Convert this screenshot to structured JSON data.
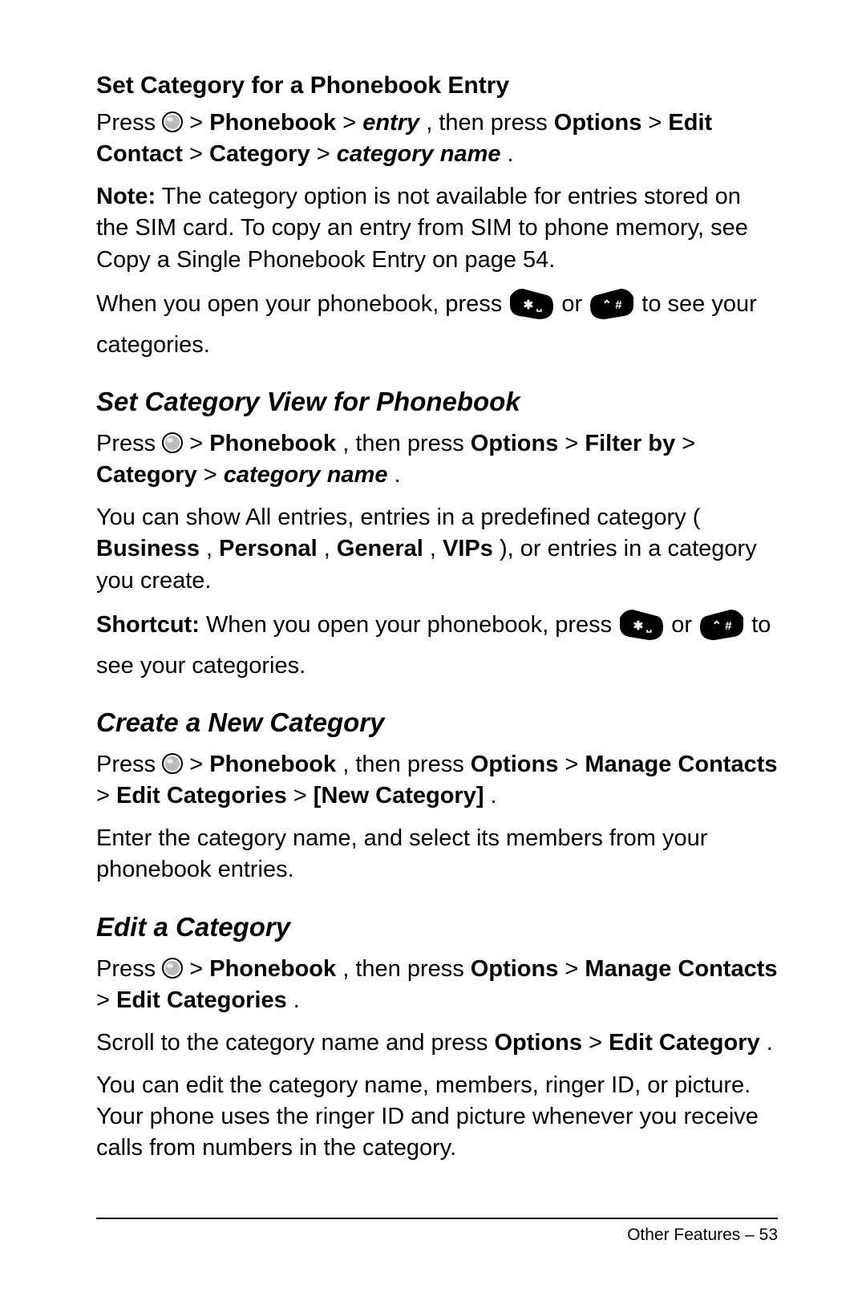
{
  "s1": {
    "title": "Set Category for a Phonebook Entry",
    "p1a": "Press ",
    "p1b": " > ",
    "p1c": "Phonebook",
    "p1d": " > ",
    "p1e": "entry",
    "p1f": ", then press ",
    "p1g": "Options",
    "p1h": " > ",
    "p1i": "Edit Contact",
    "p1j": " > ",
    "p1k": "Category",
    "p1l": " > ",
    "p1m": "category name",
    "p1n": ".",
    "note_label": "Note:",
    "note_text": " The category option is not available for entries stored on the SIM card. To copy an entry from SIM to phone memory, see Copy a Single Phonebook Entry on page 54.",
    "p3a": "When you open your phonebook, press ",
    "p3b": " or ",
    "p3c": " to see your categories."
  },
  "s2": {
    "heading": "Set Category View for Phonebook",
    "p1a": "Press ",
    "p1c": "Phonebook",
    "p1d": ", then press ",
    "p1e": "Options",
    "p1f": " > ",
    "p1g": "Filter by",
    "p1h": " > ",
    "p1i": "Category",
    "p1j": " > ",
    "p1k": "category name",
    "p1l": ".",
    "p2a": "You can show All entries, entries in a predefined category (",
    "p2b": "Business",
    "p2c": ", ",
    "p2d": "Personal",
    "p2e": ", ",
    "p2f": "General",
    "p2g": ", ",
    "p2h": "VIPs",
    "p2i": "), or entries in a category you create.",
    "p3a": "Shortcut:",
    "p3b": " When you open your phonebook, press ",
    "p3c": " or ",
    "p3d": " to see your categories."
  },
  "s3": {
    "heading": "Create a New Category",
    "p1a": "Press ",
    "p1c": "Phonebook",
    "p1d": ", then press ",
    "p1e": "Options",
    "p1f": " > ",
    "p1g": "Manage Contacts",
    "p1h": " > ",
    "p1i": "Edit Categories",
    "p1j": " > ",
    "p1k": "[New Category]",
    "p1l": ".",
    "p2": "Enter the category name, and select its members from your phonebook entries."
  },
  "s4": {
    "heading": "Edit a Category",
    "p1a": "Press ",
    "p1c": "Phonebook",
    "p1d": ", then press ",
    "p1e": "Options",
    "p1f": " > ",
    "p1g": "Manage Contacts",
    "p1h": " > ",
    "p1i": "Edit Categories",
    "p1j": ".",
    "p2a": "Scroll to the category name and press ",
    "p2b": "Options",
    "p2c": " > ",
    "p2d": "Edit Category",
    "p2e": ".",
    "p3": "You can edit the category name, members, ringer ID, or picture. Your phone uses the ringer ID and picture whenever you receive calls from numbers in the category."
  },
  "footer": "Other Features – 53"
}
